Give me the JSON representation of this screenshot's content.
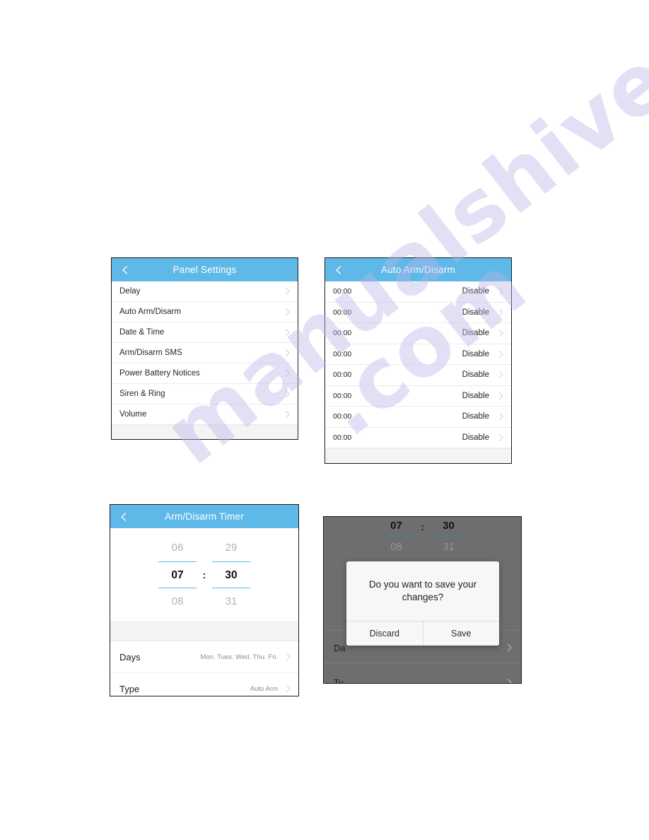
{
  "watermark": {
    "line_a": "manualshive",
    "line_b": ".com"
  },
  "panel_settings": {
    "title": "Panel Settings",
    "back_icon": "chevron-left-icon",
    "rows": [
      {
        "label": "Delay",
        "chevron": "chevron-right-icon"
      },
      {
        "label": "Auto Arm/Disarm",
        "chevron": "chevron-right-icon"
      },
      {
        "label": "Date & Time",
        "chevron": "chevron-right-icon"
      },
      {
        "label": "Arm/Disarm SMS",
        "chevron": "chevron-right-icon"
      },
      {
        "label": "Power Battery Notices",
        "chevron": "chevron-right-icon"
      },
      {
        "label": "Siren & Ring",
        "chevron": "chevron-right-icon"
      },
      {
        "label": "Volume",
        "chevron": "chevron-right-icon"
      }
    ]
  },
  "panel_auto_arm": {
    "title": "Auto Arm/Disarm",
    "back_icon": "chevron-left-icon",
    "rows": [
      {
        "time": "00:00",
        "state": "Disable"
      },
      {
        "time": "00:00",
        "state": "Disable"
      },
      {
        "time": "00:00",
        "state": "Disable"
      },
      {
        "time": "00:00",
        "state": "Disable"
      },
      {
        "time": "00:00",
        "state": "Disable"
      },
      {
        "time": "00:00",
        "state": "Disable"
      },
      {
        "time": "00:00",
        "state": "Disable"
      },
      {
        "time": "00:00",
        "state": "Disable"
      }
    ]
  },
  "panel_timer": {
    "title": "Arm/Disarm Timer",
    "back_icon": "chevron-left-icon",
    "picker": {
      "hour_prev": "06",
      "hour_selected": "07",
      "hour_next": "08",
      "separator": ":",
      "minute_prev": "29",
      "minute_selected": "30",
      "minute_next": "31",
      "highlight_color": "#4fc3e8"
    },
    "rows": [
      {
        "label": "Days",
        "value": "Mon. Tues. Wed. Thu. Fri."
      },
      {
        "label": "Type",
        "value": "Auto Arm"
      }
    ]
  },
  "panel_dialog": {
    "backdrop_color": "#6e6e6e",
    "picker": {
      "hour_selected": "07",
      "separator": ":",
      "minute_selected": "30",
      "hour_next": "08",
      "minute_next": "31"
    },
    "behind_rows": [
      {
        "label": "Da"
      },
      {
        "label": "Ty"
      }
    ],
    "dialog": {
      "message": "Do you want to save your changes?",
      "discard_label": "Discard",
      "save_label": "Save"
    }
  },
  "theme": {
    "header_blue": "#5fb9e8",
    "picker_accent": "#4fc3e8",
    "row_separator": "#ececec"
  }
}
